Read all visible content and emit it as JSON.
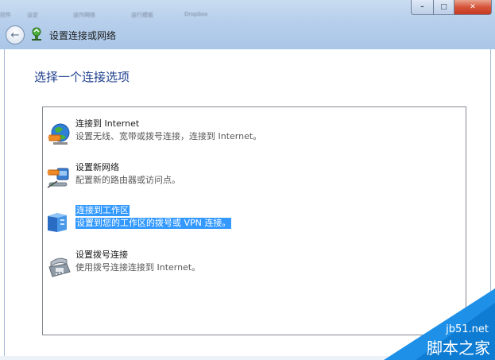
{
  "window": {
    "title": "设置连接或网络",
    "background_tabs": [
      "控件",
      "设定",
      "运作网络",
      "运行模板",
      "Dropbox"
    ],
    "controls": {
      "minimize": "–",
      "maximize": "□",
      "close": "✕"
    }
  },
  "main": {
    "heading": "选择一个连接选项",
    "options": [
      {
        "title": "连接到 Internet",
        "description": "设置无线、宽带或拨号连接，连接到 Internet。",
        "icon": "globe-network-icon",
        "selected": false
      },
      {
        "title": "设置新网络",
        "description": "配置新的路由器或访问点。",
        "icon": "router-icon",
        "selected": false
      },
      {
        "title": "连接到工作区",
        "description": "设置到您的工作区的拨号或 VPN 连接。",
        "icon": "workplace-building-icon",
        "selected": true
      },
      {
        "title": "设置拨号连接",
        "description": "使用拨号连接连接到 Internet。",
        "icon": "telephone-modem-icon",
        "selected": false
      }
    ]
  },
  "watermark": {
    "url": "jb51.net",
    "name": "脚本之家"
  },
  "colors": {
    "selection": "#3399ff",
    "heading": "#1f3f8f",
    "title_bar": "#b7cfeb"
  }
}
